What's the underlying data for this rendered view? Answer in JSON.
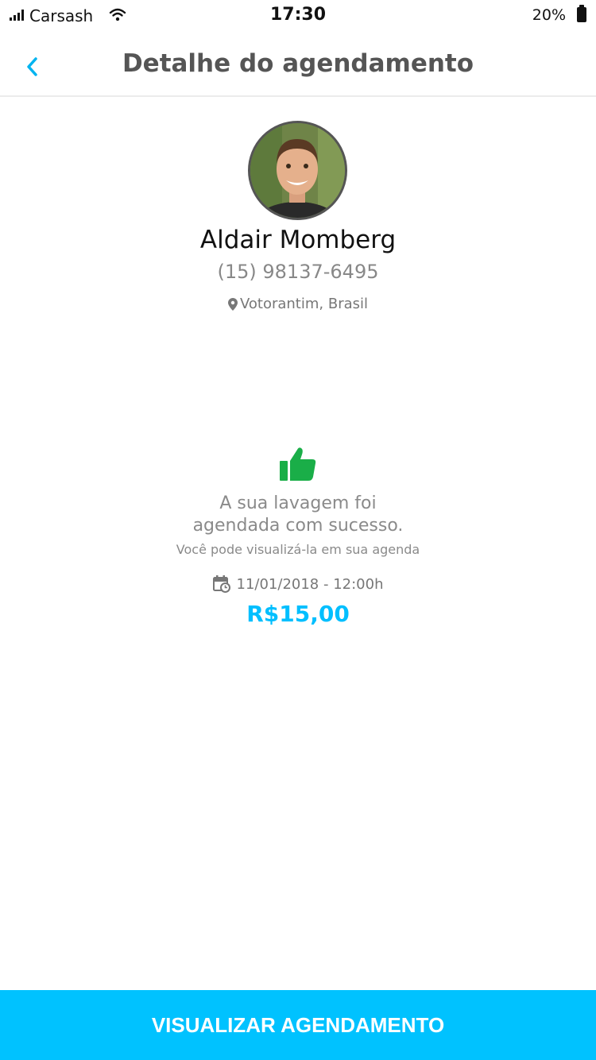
{
  "status_bar": {
    "carrier": "Carsash",
    "time": "17:30",
    "battery": "20%"
  },
  "nav": {
    "title": "Detalhe do agendamento",
    "back_icon": "chevron-left-icon"
  },
  "profile": {
    "name": "Aldair Momberg",
    "phone": "(15) 98137-6495",
    "location": "Votorantim, Brasil"
  },
  "confirmation": {
    "icon": "thumbs-up-icon",
    "message_line1": "A sua lavagem foi",
    "message_line2": "agendada com sucesso.",
    "subtext": "Você pode visualizá-la em sua agenda",
    "datetime": "11/01/2018 - 12:00h",
    "price": "R$15,00"
  },
  "cta": {
    "label": "VISUALIZAR AGENDAMENTO"
  },
  "colors": {
    "accent": "#00c2ff",
    "success": "#1aae48",
    "price": "#00bfff"
  }
}
